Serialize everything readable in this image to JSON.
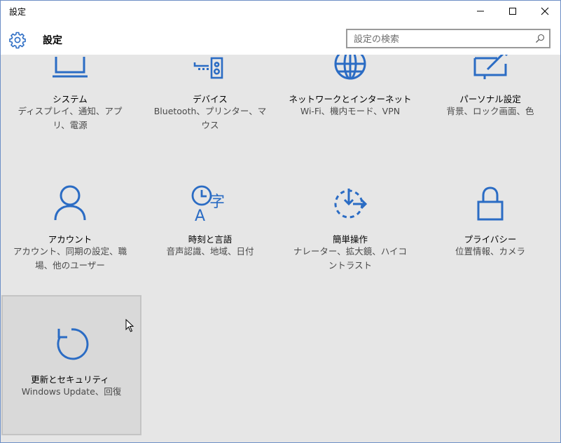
{
  "window": {
    "title": "設定"
  },
  "header": {
    "title": "設定",
    "search_placeholder": "設定の検索"
  },
  "tiles": [
    {
      "title": "システム",
      "desc": "ディスプレイ、通知、アプリ、電源"
    },
    {
      "title": "デバイス",
      "desc": "Bluetooth、プリンター、マウス"
    },
    {
      "title": "ネットワークとインターネット",
      "desc": "Wi-Fi、機内モード、VPN"
    },
    {
      "title": "パーソナル設定",
      "desc": "背景、ロック画面、色"
    },
    {
      "title": "アカウント",
      "desc": "アカウント、同期の設定、職場、他のユーザー"
    },
    {
      "title": "時刻と言語",
      "desc": "音声認識、地域、日付"
    },
    {
      "title": "簡単操作",
      "desc": "ナレーター、拡大鏡、ハイコントラスト"
    },
    {
      "title": "プライバシー",
      "desc": "位置情報、カメラ"
    },
    {
      "title": "更新とセキュリティ",
      "desc": "Windows Update、回復"
    }
  ],
  "icon_glyph": "字",
  "colors": {
    "accent": "#2b6cc4",
    "background": "#e6e6e6",
    "selected_tile": "#d9d9d9"
  },
  "icons": [
    "gear-icon",
    "search-icon",
    "laptop-icon",
    "devices-icon",
    "globe-icon",
    "personalization-icon",
    "person-icon",
    "time-language-icon",
    "ease-of-access-icon",
    "lock-icon",
    "refresh-icon"
  ]
}
